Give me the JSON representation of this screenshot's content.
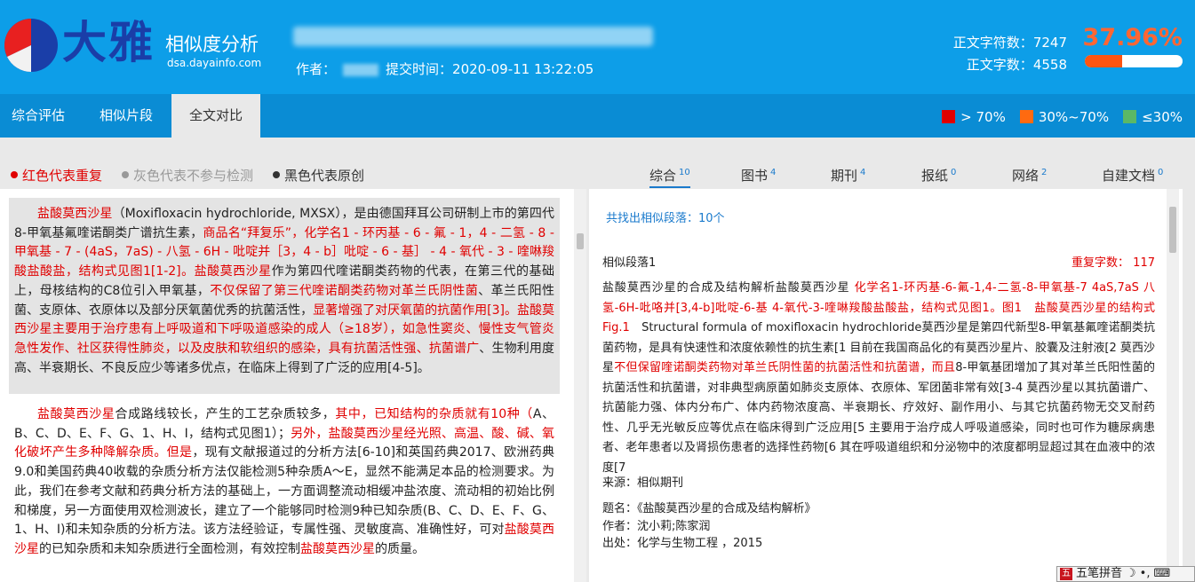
{
  "brand": {
    "logo_text": "大雅",
    "title": "相似度分析",
    "url": "dsa.dayainfo.com"
  },
  "meta": {
    "author_label": "作者：",
    "submit_label": "提交时间：",
    "submit_time": "2020-09-11 13:22:05"
  },
  "stats": {
    "char_count_label": "正文字符数：",
    "char_count": "7247",
    "word_count_label": "正文字数：",
    "word_count": "4558",
    "similarity": "37.96%",
    "similarity_fraction": 0.3796
  },
  "nav": {
    "tabs": [
      "综合评估",
      "相似片段",
      "全文对比"
    ],
    "active": 2
  },
  "legend": [
    {
      "label": "> 70%",
      "color": "#e00000"
    },
    {
      "label": "30%~70%",
      "color": "#ff6a10"
    },
    {
      "label": "≤30%",
      "color": "#5bb865"
    }
  ],
  "keys": [
    {
      "label": "红色代表重复",
      "color": "#e00000"
    },
    {
      "label": "灰色代表不参与检测",
      "color": "#999999"
    },
    {
      "label": "黑色代表原创",
      "color": "#333333"
    }
  ],
  "categories": [
    {
      "label": "综合",
      "count": "10"
    },
    {
      "label": "图书",
      "count": "4"
    },
    {
      "label": "期刊",
      "count": "4"
    },
    {
      "label": "报纸",
      "count": "0"
    },
    {
      "label": "网络",
      "count": "2"
    },
    {
      "label": "自建文档",
      "count": "0"
    }
  ],
  "left_paragraphs": {
    "p1": [
      {
        "t": "盐酸莫西沙星",
        "r": true
      },
      {
        "t": "（Moxifloxacin hydrochloride, MXSX），是由德国拜耳公司研制上市的第四代8-甲氧基氟喹诺酮类广谱抗生素，",
        "r": false
      },
      {
        "t": "商品名“拜复乐”，化学名1 - 环丙基 - 6 - 氟 - 1，4 - 二氢 - 8 - 甲氧基 - 7 - (4aS，7aS) - 八氢 - 6H - 吡啶并［3，4 - b］吡啶 - 6 - 基］ - 4 - 氧代 - 3 - 喹啉羧酸盐酸盐，结构式见图1[1-2]。盐酸莫西沙星",
        "r": true
      },
      {
        "t": "作为第四代喹诺酮类药物的代表，在第三代的基础上，母核结构的C8位引入甲氧基，",
        "r": false
      },
      {
        "t": "不仅保留了第三代喹诺酮类药物对革兰氏阴性菌",
        "r": true
      },
      {
        "t": "、革兰氏阳性菌、支原体、衣原体以及部分厌氧菌优秀的抗菌活性，",
        "r": false
      },
      {
        "t": "显著增强了对厌氧菌的抗菌作用[3]。盐酸莫西沙星主要用于治疗患有上呼吸道和下呼吸道感染的成人（≥18岁），如急性窦炎、慢性支气管炎急性发作、社区获得性肺炎，以及皮肤和软组织的感染，具有抗菌活性强、抗菌谱广",
        "r": true
      },
      {
        "t": "、生物利用度高、半衰期长、不良反应少等诸多优点，在临床上得到了广泛的应用[4-5]。",
        "r": false
      }
    ],
    "p2": [
      {
        "t": "盐酸莫西沙星",
        "r": true
      },
      {
        "t": "合成路线较长，产生的工艺杂质较多，",
        "r": false
      },
      {
        "t": "其中，已知结构的杂质就有10种（",
        "r": true
      },
      {
        "t": "A、B、C、D、E、F、G、1、H、I，结构式见图1）；",
        "r": false
      },
      {
        "t": "另外，盐酸莫西沙星经光照、高温、酸、碱、氧化破坏产生多种降解杂质。但是",
        "r": true
      },
      {
        "t": "，现有文献报道过的分析方法[6-10]和英国药典2017、欧洲药典9.0和美国药典40收载的杂质分析方法仅能检测5种杂质A～E，显然不能满足本品的检测要求。为此，我们在参考文献和药典分析方法的基础上，一方面调整流动相缓冲盐浓度、流动相的初始比例和梯度，另一方面使用双检测波长，建立了一个能够同时检测9种已知杂质(B、C、D、E、F、G、1、H、I)和未知杂质的分析方法。该方法经验证，专属性强、灵敏度高、准确性好，可对",
        "r": false
      },
      {
        "t": "盐酸莫西沙星",
        "r": true
      },
      {
        "t": "的已知杂质和未知杂质进行全面检测，有效控制",
        "r": false
      },
      {
        "t": "盐酸莫西沙星",
        "r": true
      },
      {
        "t": "的质量。",
        "r": false
      }
    ]
  },
  "right": {
    "found_label": "共找出相似段落：10个",
    "para_title": "相似段落1",
    "repeat_label": "重复字数： 117",
    "body": [
      {
        "t": "盐酸莫西沙星的合成及结构解析盐酸莫西沙星 ",
        "r": false
      },
      {
        "t": "化学名1-环丙基-6-氟-1,4-二氢-8-甲氧基-7 4aS,7aS 八氢-6H-吡咯并[3,4-b]吡啶-6-基 4-氧代-3-喹啉羧酸盐酸盐，结构式见图1。图1　盐酸莫西沙星的结构式Fig.1",
        "r": true
      },
      {
        "t": "　Structural formula of moxifloxacin hydrochloride莫西沙星是第四代新型8-甲氧基氟喹诺酮类抗菌药物，是具有快速性和浓度依赖性的抗生素[1 目前在我国商品化的有莫西沙星片、胶囊及注射液[2 莫西沙星",
        "r": false
      },
      {
        "t": "不但保留喹诺酮类药物对革兰氏阴性菌的抗菌活性和抗菌谱，而且",
        "r": true
      },
      {
        "t": "8-甲氧基团增加了其对革兰氏阳性菌的抗菌活性和抗菌谱，对非典型病原菌如肺炎支原体、衣原体、军团菌非常有效[3-4 莫西沙星以其抗菌谱广、抗菌能力强、体内分布广、体内药物浓度高、半衰期长、疗效好、副作用小、与其它抗菌药物无交叉耐药性、几乎无光敏反应等优点在临床得到广泛应用[5 主要用于治疗成人呼吸道感染，同时也可作为糖尿病患者、老年患者以及肾损伤患者的选择性药物[6 其在呼吸道组织和分泌物中的浓度都明显超过其在血液中的浓度[7",
        "r": false
      }
    ],
    "source": "来源：相似期刊",
    "info_title": "题名：《盐酸莫西沙星的合成及结构解析》",
    "info_author": "作者：沈小莉;陈家润",
    "info_origin": "出处：化学与生物工程 ，2015"
  },
  "ime": {
    "label": "五笔拼音"
  }
}
